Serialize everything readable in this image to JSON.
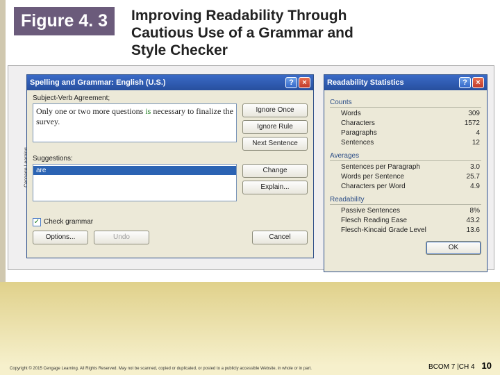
{
  "slide": {
    "figure_label": "Figure 4. 3",
    "title": "Improving Readability Through Cautious Use of a Grammar and Style Checker",
    "credit": "Cengage Learning",
    "copyright": "Copyright © 2015 Cengage Learning. All Rights Reserved. May not be scanned, copied or duplicated, or posted to a publicly accessible Website, in whole or in part.",
    "book": "BCOM 7 |CH 4",
    "page": "10"
  },
  "grammar_window": {
    "title": "Spelling and Grammar: English (U.S.)",
    "issue_label": "Subject-Verb Agreement;",
    "sentence_pre": "Only one or two more questions ",
    "sentence_err": "is",
    "sentence_post": " necessary to finalize the survey.",
    "suggestions_label": "Suggestions:",
    "suggestion": "are",
    "buttons": {
      "ignore_once": "Ignore Once",
      "ignore_rule": "Ignore Rule",
      "next_sentence": "Next Sentence",
      "change": "Change",
      "explain": "Explain...",
      "options": "Options...",
      "undo": "Undo",
      "cancel": "Cancel"
    },
    "check_label": "Check grammar"
  },
  "stats_window": {
    "title": "Readability Statistics",
    "sections": {
      "counts": "Counts",
      "averages": "Averages",
      "readability": "Readability"
    },
    "counts": {
      "words_l": "Words",
      "words_v": "309",
      "chars_l": "Characters",
      "chars_v": "1572",
      "paras_l": "Paragraphs",
      "paras_v": "4",
      "sents_l": "Sentences",
      "sents_v": "12"
    },
    "averages": {
      "spp_l": "Sentences per Paragraph",
      "spp_v": "3.0",
      "wps_l": "Words per Sentence",
      "wps_v": "25.7",
      "cpw_l": "Characters per Word",
      "cpw_v": "4.9"
    },
    "readability": {
      "ps_l": "Passive Sentences",
      "ps_v": "8%",
      "fre_l": "Flesch Reading Ease",
      "fre_v": "43.2",
      "fkg_l": "Flesch-Kincaid Grade Level",
      "fkg_v": "13.6"
    },
    "ok": "OK"
  }
}
